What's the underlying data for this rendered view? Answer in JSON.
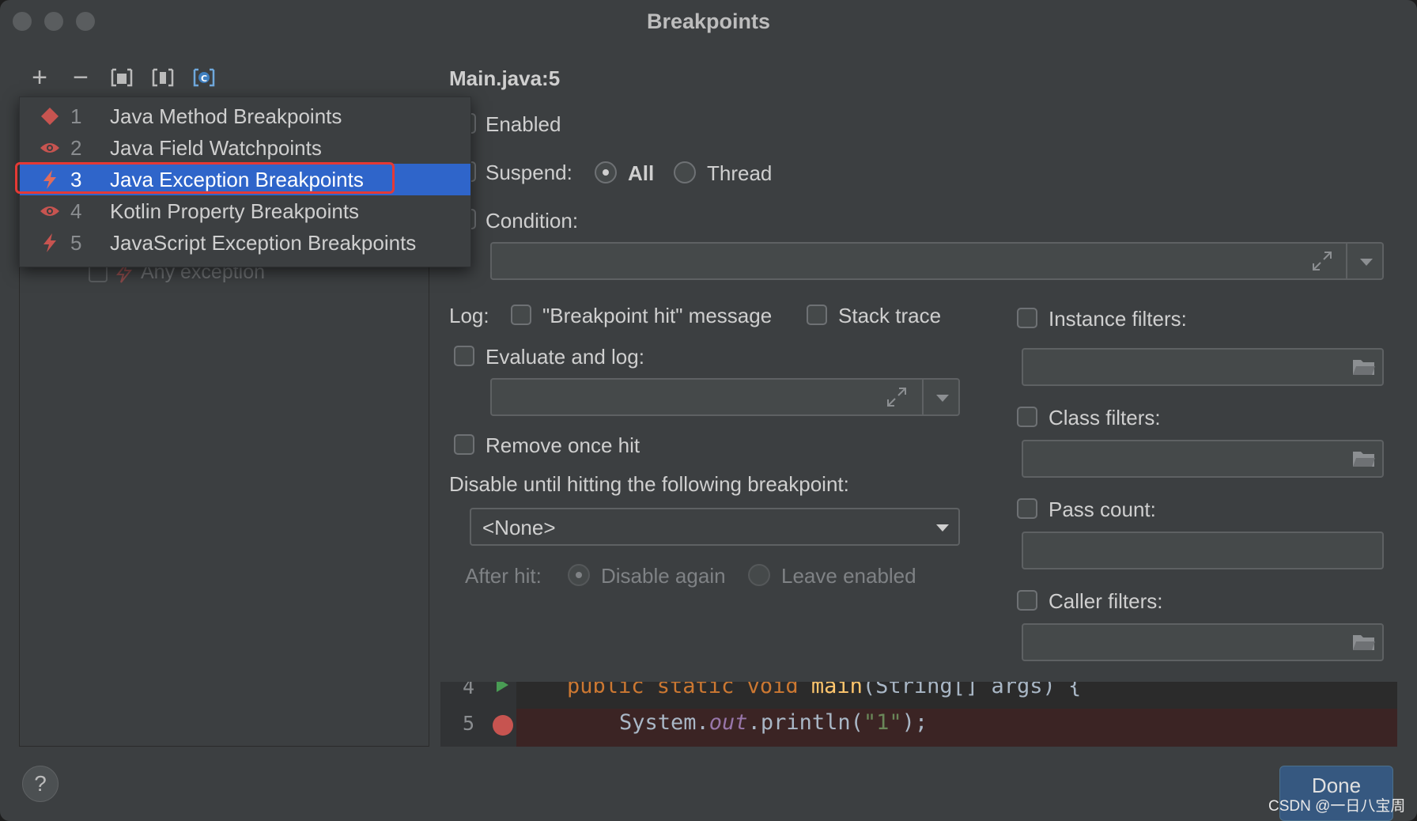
{
  "window": {
    "title": "Breakpoints"
  },
  "toolbar": {
    "buttons": [
      {
        "name": "add",
        "glyph": "+"
      },
      {
        "name": "remove",
        "glyph": "−"
      }
    ]
  },
  "add_menu": {
    "items": [
      {
        "num": "1",
        "label": "Java Method Breakpoints",
        "icon": "diamond-icon"
      },
      {
        "num": "2",
        "label": "Java Field Watchpoints",
        "icon": "eye-icon"
      },
      {
        "num": "3",
        "label": "Java Exception Breakpoints",
        "icon": "lightning-icon",
        "selected": true
      },
      {
        "num": "4",
        "label": "Kotlin Property Breakpoints",
        "icon": "eye-icon"
      },
      {
        "num": "5",
        "label": "JavaScript Exception Breakpoints",
        "icon": "lightning-icon"
      }
    ]
  },
  "tree": {
    "any_exception": "Any exception"
  },
  "details": {
    "heading": "Main.java:5",
    "enabled": "Enabled",
    "suspend": "Suspend:",
    "suspend_all": "All",
    "suspend_thread": "Thread",
    "condition": "Condition:",
    "log": "Log:",
    "log_message": "\"Breakpoint hit\" message",
    "stack_trace": "Stack trace",
    "evaluate_and_log": "Evaluate and log:",
    "remove_once_hit": "Remove once hit",
    "disable_until": "Disable until hitting the following breakpoint:",
    "disable_until_value": "<None>",
    "after_hit": "After hit:",
    "disable_again": "Disable again",
    "leave_enabled": "Leave enabled"
  },
  "filters": {
    "instance": "Instance filters:",
    "class": "Class filters:",
    "pass_count": "Pass count:",
    "caller": "Caller filters:"
  },
  "code": {
    "line4_no": "4",
    "line5_no": "5",
    "line4_kw": "public static void ",
    "line4_fn": "main",
    "line4_rest": "(String[] args) {",
    "line5_obj": "System.",
    "line5_field": "out",
    "line5_call": ".println(",
    "line5_str": "\"1\"",
    "line5_end": ");"
  },
  "footer": {
    "help": "?",
    "done": "Done"
  },
  "watermark": "CSDN @一日八宝周"
}
